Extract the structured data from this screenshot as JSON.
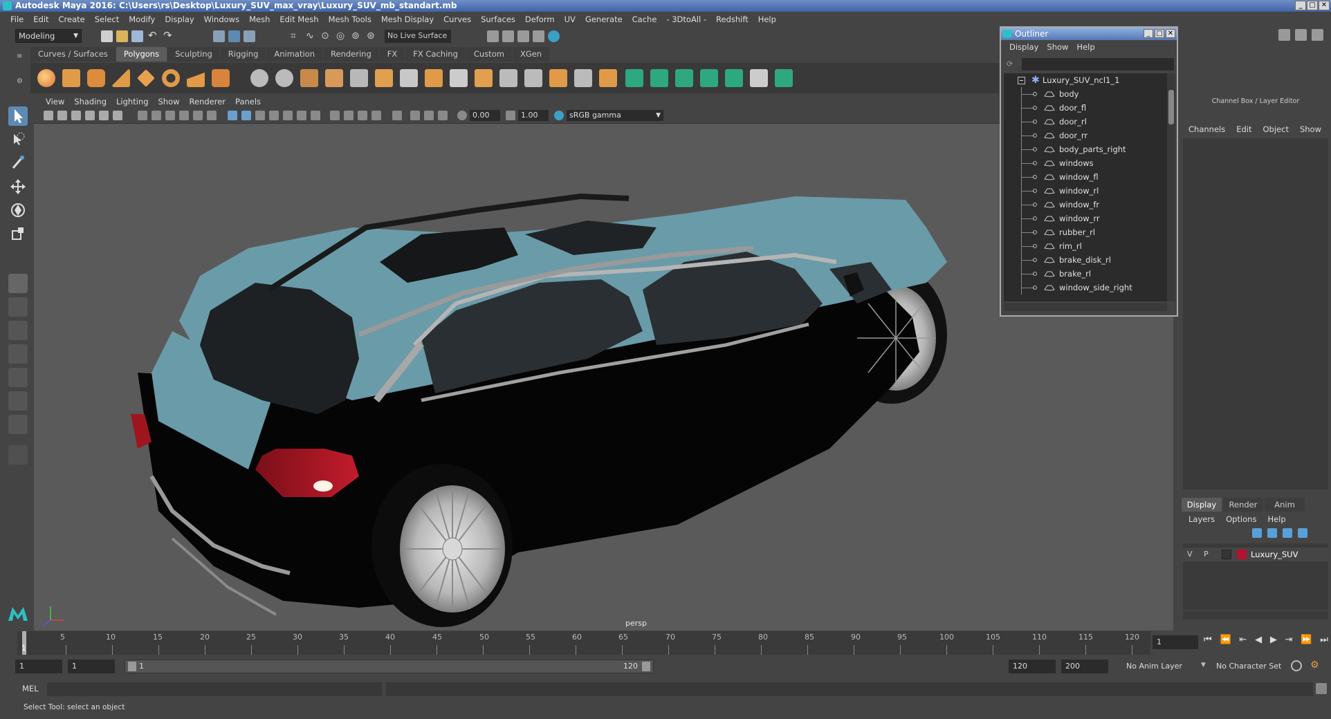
{
  "window": {
    "title": "Autodesk Maya 2016: C:\\Users\\rs\\Desktop\\Luxury_SUV_max_vray\\Luxury_SUV_mb_standart.mb",
    "controls": [
      "_",
      "□",
      "✕"
    ]
  },
  "menubar": [
    "File",
    "Edit",
    "Create",
    "Select",
    "Modify",
    "Display",
    "Windows",
    "Mesh",
    "Edit Mesh",
    "Mesh Tools",
    "Mesh Display",
    "Curves",
    "Surfaces",
    "Deform",
    "UV",
    "Generate",
    "Cache",
    "- 3DtoAll -",
    "Redshift",
    "Help"
  ],
  "statusline": {
    "mode": "Modeling",
    "live_surface": "No Live Surface"
  },
  "shelf": {
    "tabs": [
      "Curves / Surfaces",
      "Polygons",
      "Sculpting",
      "Rigging",
      "Animation",
      "Rendering",
      "FX",
      "FX Caching",
      "Custom",
      "XGen"
    ],
    "active_tab": "Polygons"
  },
  "panel": {
    "menu": [
      "View",
      "Shading",
      "Lighting",
      "Show",
      "Renderer",
      "Panels"
    ],
    "exposure": "0.00",
    "gamma": "1.00",
    "color_space": "sRGB gamma",
    "camera_label": "persp"
  },
  "outliner": {
    "title": "Outliner",
    "menu": [
      "Display",
      "Show",
      "Help"
    ],
    "root": "Luxury_SUV_ncl1_1",
    "items": [
      "body",
      "door_fl",
      "door_rl",
      "door_rr",
      "body_parts_right",
      "windows",
      "window_fl",
      "window_rl",
      "window_fr",
      "window_rr",
      "rubber_rl",
      "rim_rl",
      "brake_disk_rl",
      "brake_rl",
      "window_side_right"
    ]
  },
  "channel_box": {
    "title": "Channel Box / Layer Editor",
    "menu": [
      "Channels",
      "Edit",
      "Object",
      "Show"
    ],
    "layer_tabs": [
      "Display",
      "Render",
      "Anim"
    ],
    "active_layer_tab": "Display",
    "layer_menu": [
      "Layers",
      "Options",
      "Help"
    ],
    "layer": {
      "v": "V",
      "p": "P",
      "name": "Luxury_SUV",
      "color": "#b8102f"
    }
  },
  "timeline": {
    "ticks": [
      "5",
      "10",
      "15",
      "20",
      "25",
      "30",
      "35",
      "40",
      "45",
      "50",
      "55",
      "60",
      "65",
      "70",
      "75",
      "80",
      "85",
      "90",
      "95",
      "100",
      "105",
      "110",
      "115",
      "120"
    ],
    "current_frame_marker": "1",
    "current_frame": "1"
  },
  "range": {
    "start": "1",
    "playback_start": "1",
    "slider_start": "1",
    "slider_end": "120",
    "playback_end": "120",
    "end": "200",
    "anim_layer": "No Anim Layer",
    "character_set": "No Character Set"
  },
  "command_line": {
    "label": "MEL"
  },
  "help_line": "Select Tool: select an object"
}
